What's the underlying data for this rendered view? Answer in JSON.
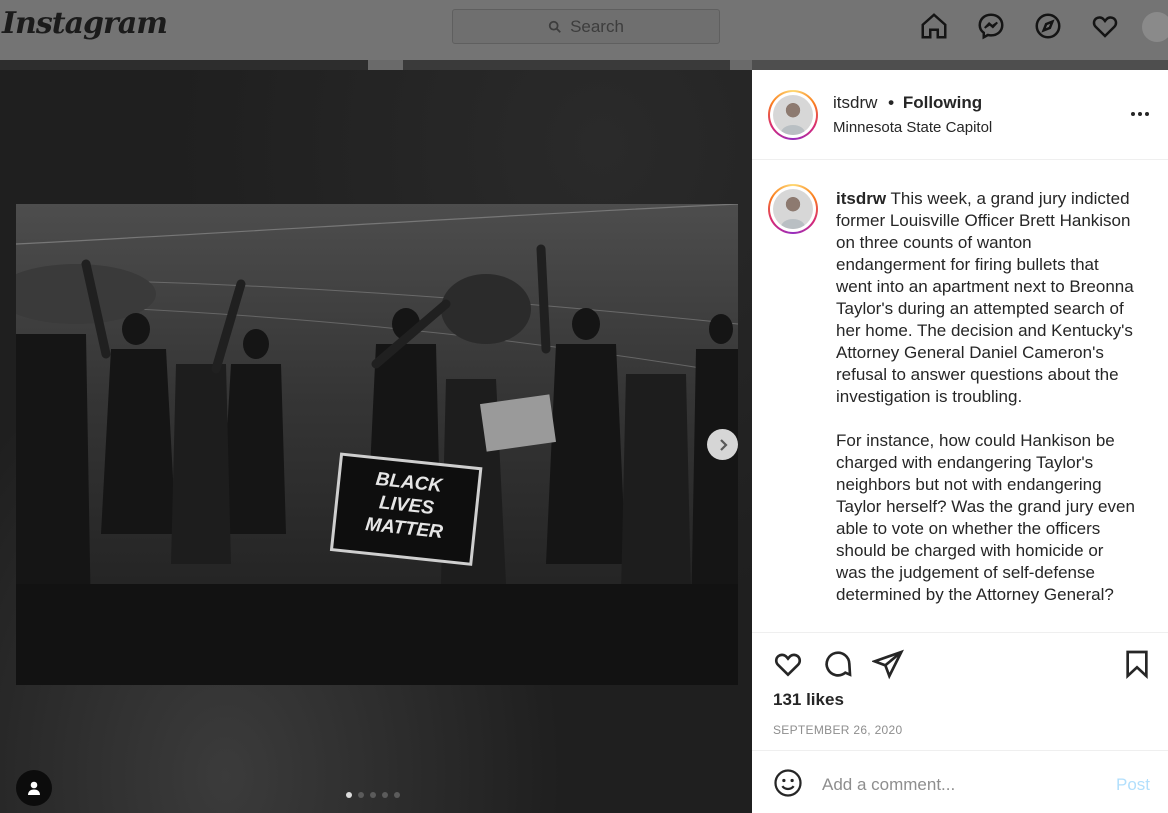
{
  "app": {
    "logo": "Instagram",
    "search": {
      "placeholder": "Search",
      "icon": "search-icon"
    },
    "nav_icons": [
      "home-icon",
      "messenger-icon",
      "explore-icon",
      "heart-icon",
      "profile-avatar"
    ]
  },
  "post": {
    "header": {
      "username": "itsdrw",
      "separator": "•",
      "follow_status": "Following",
      "location": "Minnesota State Capitol"
    },
    "caption": {
      "username": "itsdrw",
      "paragraphs": [
        "This week, a grand jury indicted former Louisville Officer Brett Hankison on three counts of wanton endangerment for firing bullets that went into an apartment next to Breonna Taylor's during an attempted search of her home. The decision and Kentucky's Attorney General Daniel Cameron's refusal to answer questions about the investigation is troubling.",
        "For instance, how could Hankison be charged with endangering Taylor's neighbors but not with endangering Taylor herself? Was the grand jury even able to vote on whether the officers should be charged with homicide or was the judgement of self-defense determined by the Attorney General?"
      ]
    },
    "media": {
      "carousel_count": 5,
      "active_index": 0,
      "sign_lines": [
        "BLACK",
        "LIVES",
        "MATTER"
      ]
    },
    "likes": "131 likes",
    "date": "SEPTEMBER 26, 2020",
    "comment": {
      "placeholder": "Add a comment...",
      "post_label": "Post"
    }
  },
  "colors": {
    "overlay": "#4e4e4e",
    "panel": "#ffffff",
    "text": "#262626",
    "muted": "#8e8e8e",
    "post_disabled": "#b2dffc"
  }
}
